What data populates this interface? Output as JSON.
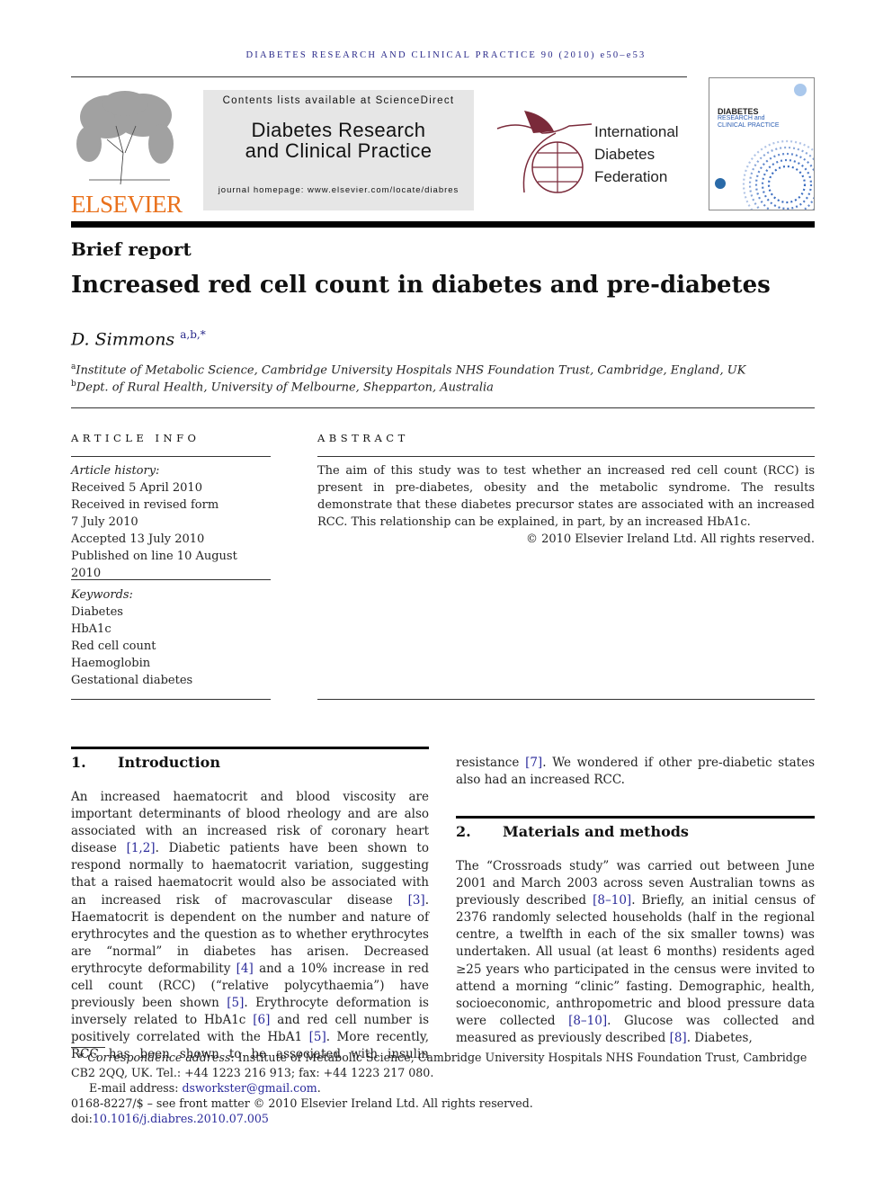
{
  "running_head": "DIABETES RESEARCH AND CLINICAL PRACTICE 90 (2010) e50–e53",
  "publisher": {
    "logo_text": "ELSEVIER"
  },
  "journal_box": {
    "contents": "Contents lists available at ScienceDirect",
    "title_line1": "Diabetes Research",
    "title_line2": "and Clinical Practice",
    "homepage": "journal homepage: www.elsevier.com/locate/diabres"
  },
  "idf": {
    "line1": "International",
    "line2": "Diabetes",
    "line3": "Federation"
  },
  "cover": {
    "title1": "DIABETES",
    "title2": "RESEARCH and",
    "title3": "CLINICAL PRACTICE"
  },
  "colors": {
    "elsevier_orange": "#e9711c",
    "link_blue": "#2a2a9a",
    "idf_maroon": "#7a2a3a"
  },
  "article_type": "Brief report",
  "title": "Increased red cell count in diabetes and pre-diabetes",
  "author": {
    "name": "D. Simmons",
    "marks": "a,b,*"
  },
  "affiliations": [
    {
      "mark": "a",
      "text": "Institute of Metabolic Science, Cambridge University Hospitals NHS Foundation Trust, Cambridge, England, UK"
    },
    {
      "mark": "b",
      "text": "Dept. of Rural Health, University of Melbourne, Shepparton, Australia"
    }
  ],
  "article_info": {
    "heading": "ARTICLE INFO",
    "history_label": "Article history:",
    "history": [
      "Received 5 April 2010",
      "Received in revised form",
      "7 July 2010",
      "Accepted 13 July 2010",
      "Published on line 10 August 2010"
    ],
    "keywords_label": "Keywords:",
    "keywords": [
      "Diabetes",
      "HbA1c",
      "Red cell count",
      "Haemoglobin",
      "Gestational diabetes"
    ]
  },
  "abstract": {
    "heading": "ABSTRACT",
    "text": "The aim of this study was to test whether an increased red cell count (RCC) is present in pre-diabetes, obesity and the metabolic syndrome. The results demonstrate that these diabetes precursor states are associated with an increased RCC. This relationship can be explained, in part, by an increased HbA1c.",
    "copyright": "© 2010 Elsevier Ireland Ltd. All rights reserved."
  },
  "sections": [
    {
      "number": "1.",
      "title": "Introduction",
      "col1": [
        {
          "t": "An increased haematocrit and blood viscosity are important determinants of blood rheology and are also associated with an increased risk of coronary heart disease "
        },
        {
          "r": "[1,2]"
        },
        {
          "t": ". Diabetic patients have been shown to respond normally to haematocrit variation, suggesting that a raised haematocrit would also be associated with an increased risk of macrovascular disease "
        },
        {
          "r": "[3]"
        },
        {
          "t": ". Haematocrit is dependent on the number and nature of erythrocytes and the question as to whether erythrocytes are “normal” in diabetes has arisen. Decreased erythrocyte deformability "
        },
        {
          "r": "[4]"
        },
        {
          "t": " and a 10% increase in red cell count (RCC) (“relative polycythaemia”) have previously been shown "
        },
        {
          "r": "[5]"
        },
        {
          "t": ". Erythrocyte deformation is inversely related to HbA1c "
        },
        {
          "r": "[6]"
        },
        {
          "t": " and red cell number is positively correlated with the HbA1 "
        },
        {
          "r": "[5]"
        },
        {
          "t": ". More recently, RCC has been shown to be associated with insulin"
        }
      ],
      "col2": [
        {
          "t": "resistance "
        },
        {
          "r": "[7]"
        },
        {
          "t": ". We wondered if other pre-diabetic states also had an increased RCC."
        }
      ]
    },
    {
      "number": "2.",
      "title": "Materials and methods",
      "col2": [
        {
          "t": "The “Crossroads study” was carried out between June 2001 and March 2003 across seven Australian towns as previously described "
        },
        {
          "r": "[8–10]"
        },
        {
          "t": ". Briefly, an initial census of 2376 randomly selected households (half in the regional centre, a twelfth in each of the six smaller towns) was undertaken. All usual (at least 6 months) residents aged ≥25 years who participated in the census were invited to attend a morning “clinic” fasting. Demographic, health, socioeconomic, anthropometric and blood pressure data were collected "
        },
        {
          "r": "[8–10]"
        },
        {
          "t": ". Glucose was collected and measured as previously described "
        },
        {
          "r": "[8]"
        },
        {
          "t": ". Diabetes,"
        }
      ]
    }
  ],
  "footnotes": {
    "corr_mark": "*",
    "corr_label": "Correspondence address",
    "corr_text": ": Institute of Metabolic Science, Cambridge University Hospitals NHS Foundation Trust, Cambridge CB2 2QQ, UK. Tel.: +44 1223 216 913; fax: +44 1223 217 080.",
    "email_label": "E-mail address: ",
    "email": "dsworkster@gmail.com",
    "front_matter": "0168-8227/$ – see front matter © 2010 Elsevier Ireland Ltd. All rights reserved.",
    "doi_label": "doi:",
    "doi": "10.1016/j.diabres.2010.07.005"
  }
}
